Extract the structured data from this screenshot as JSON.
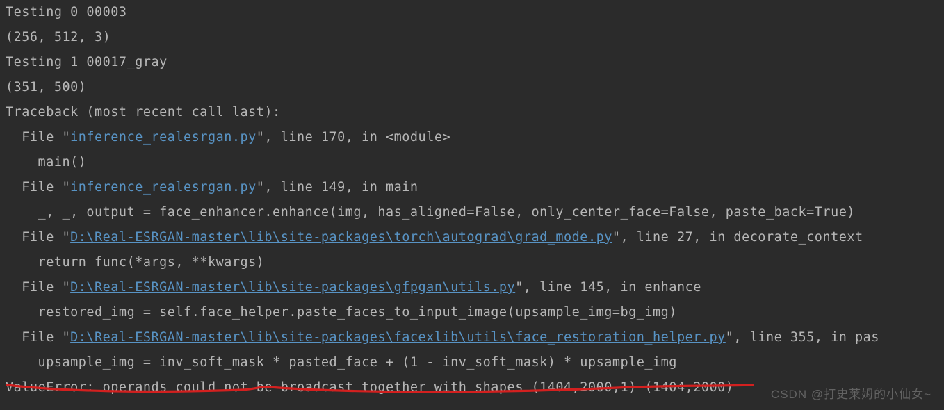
{
  "console": {
    "lines": [
      {
        "segments": [
          {
            "text": "Testing 0 00003",
            "link": false
          }
        ]
      },
      {
        "segments": [
          {
            "text": "(256, 512, 3)",
            "link": false
          }
        ]
      },
      {
        "segments": [
          {
            "text": "Testing 1 00017_gray",
            "link": false
          }
        ]
      },
      {
        "segments": [
          {
            "text": "(351, 500)",
            "link": false
          }
        ]
      },
      {
        "segments": [
          {
            "text": "Traceback (most recent call last):",
            "link": false
          }
        ]
      },
      {
        "segments": [
          {
            "text": "  File \"",
            "link": false
          },
          {
            "text": "inference_realesrgan.py",
            "link": true
          },
          {
            "text": "\", line 170, in <module>",
            "link": false
          }
        ]
      },
      {
        "segments": [
          {
            "text": "    main()",
            "link": false
          }
        ]
      },
      {
        "segments": [
          {
            "text": "  File \"",
            "link": false
          },
          {
            "text": "inference_realesrgan.py",
            "link": true
          },
          {
            "text": "\", line 149, in main",
            "link": false
          }
        ]
      },
      {
        "segments": [
          {
            "text": "    _, _, output = face_enhancer.enhance(img, has_aligned=False, only_center_face=False, paste_back=True)",
            "link": false
          }
        ]
      },
      {
        "segments": [
          {
            "text": "  File \"",
            "link": false
          },
          {
            "text": "D:\\Real-ESRGAN-master\\lib\\site-packages\\torch\\autograd\\grad_mode.py",
            "link": true
          },
          {
            "text": "\", line 27, in decorate_context",
            "link": false
          }
        ]
      },
      {
        "segments": [
          {
            "text": "    return func(*args, **kwargs)",
            "link": false
          }
        ]
      },
      {
        "segments": [
          {
            "text": "  File \"",
            "link": false
          },
          {
            "text": "D:\\Real-ESRGAN-master\\lib\\site-packages\\gfpgan\\utils.py",
            "link": true
          },
          {
            "text": "\", line 145, in enhance",
            "link": false
          }
        ]
      },
      {
        "segments": [
          {
            "text": "    restored_img = self.face_helper.paste_faces_to_input_image(upsample_img=bg_img)",
            "link": false
          }
        ]
      },
      {
        "segments": [
          {
            "text": "  File \"",
            "link": false
          },
          {
            "text": "D:\\Real-ESRGAN-master\\lib\\site-packages\\facexlib\\utils\\face_restoration_helper.py",
            "link": true
          },
          {
            "text": "\", line 355, in pas",
            "link": false
          }
        ]
      },
      {
        "segments": [
          {
            "text": "    upsample_img = inv_soft_mask * pasted_face + (1 - inv_soft_mask) * upsample_img",
            "link": false
          }
        ]
      },
      {
        "segments": [
          {
            "text": "ValueError: operands could not be broadcast together with shapes (1404,2000,1) (1404,2000) ",
            "link": false
          }
        ]
      }
    ]
  },
  "watermark": "CSDN @打史莱姆的小仙女~"
}
